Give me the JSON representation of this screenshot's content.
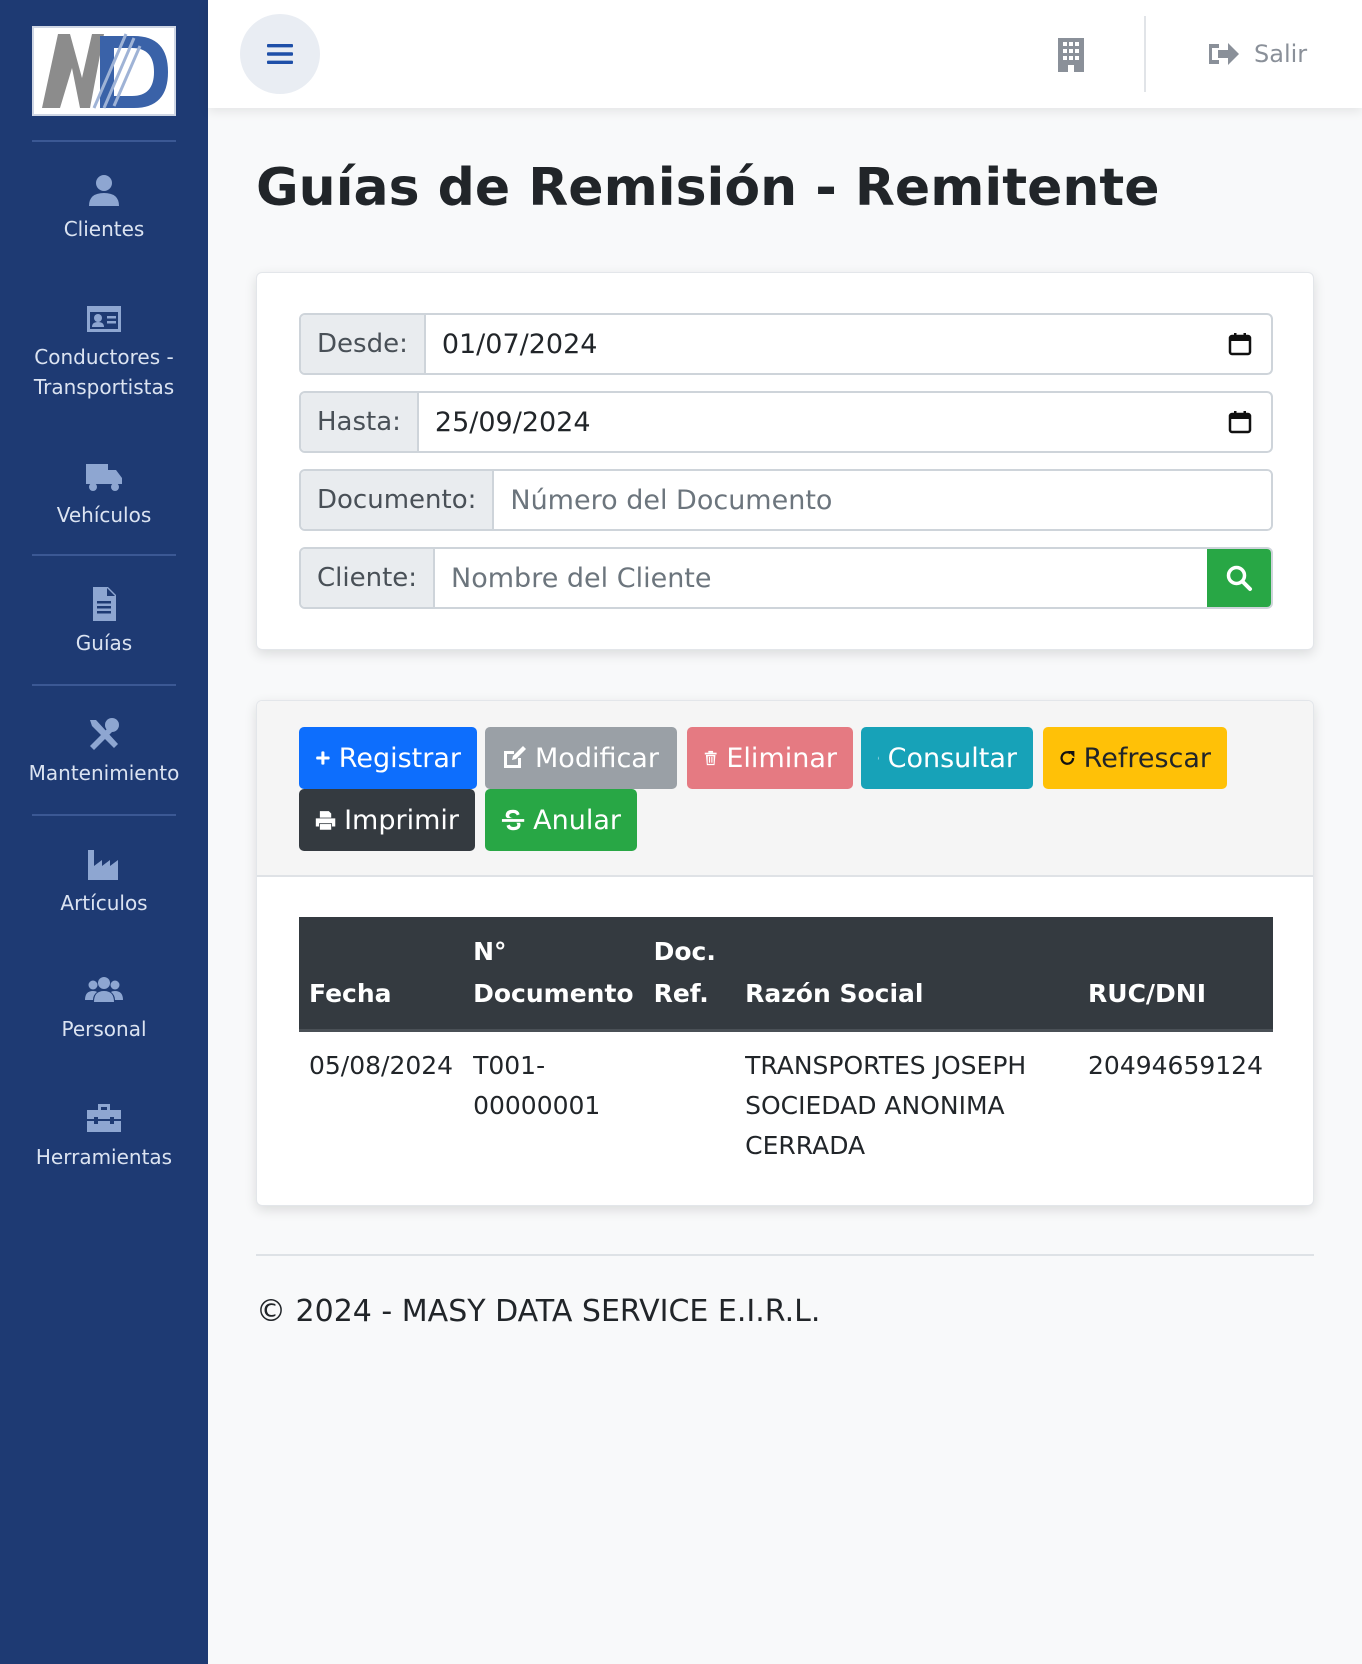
{
  "sidebar": {
    "items": [
      {
        "label": "Clientes",
        "icon": "user-icon"
      },
      {
        "label": "Conductores -",
        "label2": "Transportistas",
        "icon": "id-card-icon"
      },
      {
        "label": "Vehículos",
        "icon": "truck-icon"
      },
      {
        "label": "Guías",
        "icon": "file-icon"
      },
      {
        "label": "Mantenimiento",
        "icon": "tools-icon"
      },
      {
        "label": "Artículos",
        "icon": "industry-icon"
      },
      {
        "label": "Personal",
        "icon": "users-icon"
      },
      {
        "label": "Herramientas",
        "icon": "toolbox-icon"
      }
    ],
    "color": "#1e3a73"
  },
  "topbar": {
    "logout_label": "Salir"
  },
  "page": {
    "title": "Guías de Remisión - Remitente"
  },
  "filters": {
    "desde_label": "Desde:",
    "desde_value": "01/07/2024",
    "hasta_label": "Hasta:",
    "hasta_value": "25/09/2024",
    "documento_label": "Documento:",
    "documento_placeholder": "Número del Documento",
    "cliente_label": "Cliente:",
    "cliente_placeholder": "Nombre del Cliente"
  },
  "toolbar": {
    "registrar": "Registrar",
    "modificar": "Modificar",
    "eliminar": "Eliminar",
    "consultar": "Consultar",
    "refrescar": "Refrescar",
    "imprimir": "Imprimir",
    "anular": "Anular"
  },
  "table": {
    "headers": {
      "fecha": "Fecha",
      "n_documento_1": "N°",
      "n_documento_2": "Documento",
      "doc_ref_1": "Doc.",
      "doc_ref_2": "Ref.",
      "razon_social": "Razón Social",
      "ruc": "RUC/DNI"
    },
    "rows": [
      {
        "fecha": "05/08/2024",
        "documento_1": "T001-",
        "documento_2": "00000001",
        "doc_ref": "",
        "razon_1": "TRANSPORTES JOSEPH",
        "razon_2": "SOCIEDAD ANONIMA",
        "razon_3": "CERRADA",
        "ruc": "20494659124"
      }
    ]
  },
  "footer": {
    "text": "© 2024 - MASY DATA SERVICE E.I.R.L."
  }
}
